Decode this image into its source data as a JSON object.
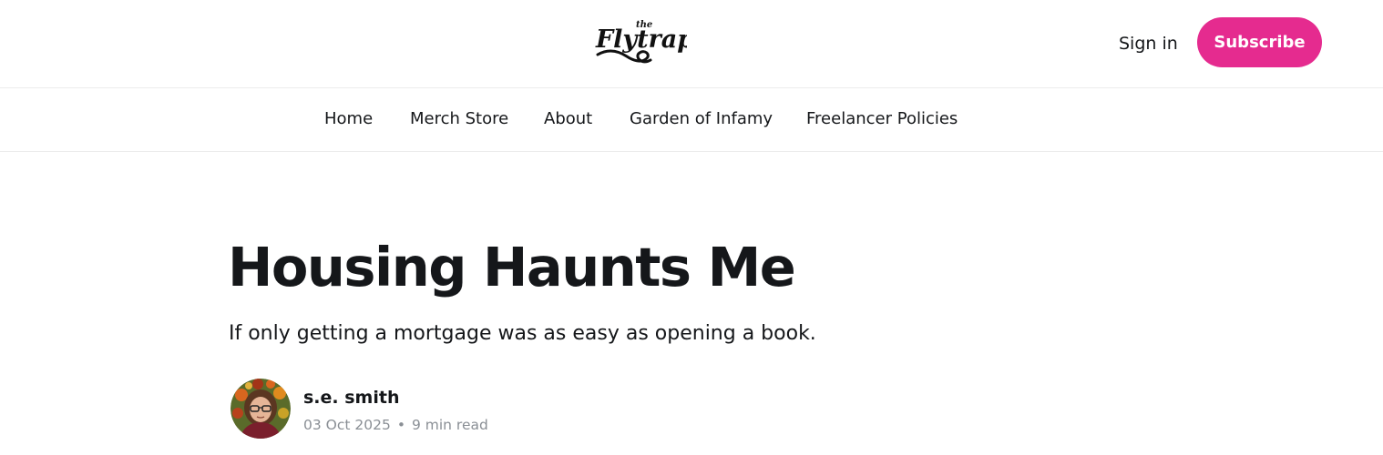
{
  "header": {
    "logo_alt": "the Flytrap",
    "signin_label": "Sign in",
    "subscribe_label": "Subscribe",
    "accent_color": "#e52b8f"
  },
  "nav": {
    "items": [
      {
        "label": "Home"
      },
      {
        "label": "Merch Store"
      },
      {
        "label": "About"
      },
      {
        "label": "Garden of Infamy"
      },
      {
        "label": "Freelancer Policies"
      }
    ]
  },
  "article": {
    "title": "Housing Haunts Me",
    "subtitle": "If only getting a mortgage was as easy as opening a book.",
    "author": "s.e. smith",
    "date": "03 Oct 2025",
    "separator": "•",
    "read_time": "9 min read"
  }
}
